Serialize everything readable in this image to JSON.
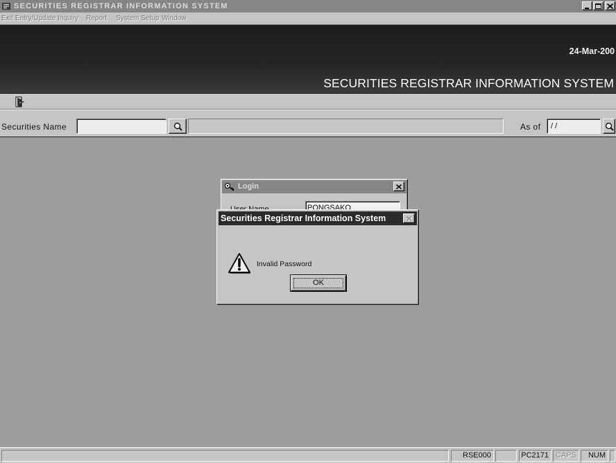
{
  "window": {
    "title": "SECURITIES REGISTRAR INFORMATION SYSTEM",
    "icon": "app-icon",
    "controls": [
      "minimize-icon",
      "maximize-icon",
      "close-icon"
    ]
  },
  "menu": {
    "items": [
      "Exit",
      "Entry/Update",
      "Inquiry",
      "Report",
      "System Setup",
      "Window"
    ]
  },
  "banner": {
    "date": "24-Mar-200",
    "title": "SECURITIES REGISTRAR INFORMATION SYSTEM"
  },
  "toolbar": {
    "exit_icon": "exit-door-icon"
  },
  "search": {
    "securities_name_label": "Securities Name",
    "lookup_icon": "lookup-icon",
    "as_of_label": "As of",
    "as_of_value": "/ /"
  },
  "login_dialog": {
    "title": "Login",
    "icon": "key-icon",
    "user_name_label": "User Name",
    "user_name_value": "PONGSAKO"
  },
  "message_box": {
    "title": "Securities Registrar Information System",
    "icon": "warning-icon",
    "message": "Invalid Password",
    "ok_label": "OK"
  },
  "status_bar": {
    "user_id": "RSE000",
    "workstation": "PC2171",
    "caps": "CAPS",
    "num": "NUM"
  },
  "colors": {
    "face": "#c5c5c5",
    "workspace": "#9e9e9e",
    "inactive_title": "#858585",
    "active_title": "#2b2b2b",
    "banner": "#1e1e1e"
  }
}
